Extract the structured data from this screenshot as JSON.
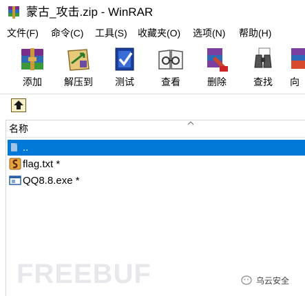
{
  "window": {
    "title": "蒙古_攻击.zip - WinRAR"
  },
  "menu": [
    "文件(F)",
    "命令(C)",
    "工具(S)",
    "收藏夹(O)",
    "选项(N)",
    "帮助(H)"
  ],
  "toolbar": [
    {
      "label": "添加",
      "icon": "archive-add-icon"
    },
    {
      "label": "解压到",
      "icon": "extract-to-icon"
    },
    {
      "label": "测试",
      "icon": "test-icon"
    },
    {
      "label": "查看",
      "icon": "view-icon"
    },
    {
      "label": "删除",
      "icon": "delete-icon"
    },
    {
      "label": "查找",
      "icon": "find-icon"
    },
    {
      "label": "向",
      "icon": "wizard-icon"
    }
  ],
  "filelist": {
    "column_name": "名称",
    "rows": [
      {
        "name": "..",
        "selected": true,
        "icon": "parent-folder-icon"
      },
      {
        "name": "flag.txt *",
        "selected": false,
        "icon": "rar-file-icon"
      },
      {
        "name": "QQ8.8.exe *",
        "selected": false,
        "icon": "exe-file-icon"
      }
    ]
  },
  "watermark": {
    "brand": "FREEBUF",
    "caption": "乌云安全"
  },
  "colors": {
    "selection": "#0078d7",
    "background": "#ffffff"
  }
}
